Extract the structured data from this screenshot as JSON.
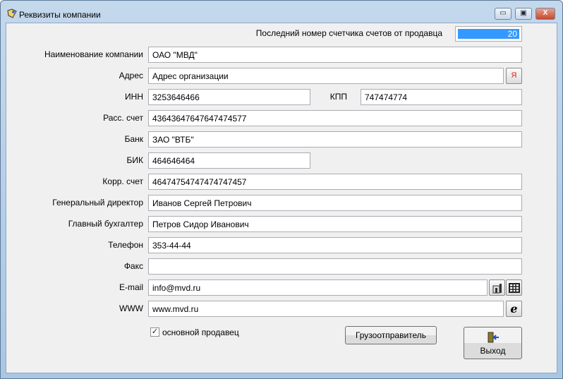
{
  "window": {
    "title": "Реквизиты компании",
    "minimize": "▭",
    "maximize": "▣",
    "close": "X"
  },
  "counter": {
    "label": "Последний номер счетчика счетов от продавца",
    "value": "20"
  },
  "fields": {
    "name": {
      "label": "Наименование компании",
      "value": "ОАО \"МВД\""
    },
    "address": {
      "label": "Адрес",
      "value": "Адрес организации",
      "button": "Я"
    },
    "inn": {
      "label": "ИНН",
      "value": "3253646466"
    },
    "kpp": {
      "label": "КПП",
      "value": "747474774"
    },
    "account": {
      "label": "Расс. счет",
      "value": "43643647647647474577"
    },
    "bank": {
      "label": "Банк",
      "value": "ЗАО \"ВТБ\""
    },
    "bik": {
      "label": "БИК",
      "value": "464646464"
    },
    "corr": {
      "label": "Корр. счет",
      "value": "46474754747474747457"
    },
    "director": {
      "label": "Генеральный директор",
      "value": "Иванов Сергей Петрович"
    },
    "accountant": {
      "label": "Главный бухгалтер",
      "value": "Петров Сидор Иванович"
    },
    "phone": {
      "label": "Телефон",
      "value": "353-44-44"
    },
    "fax": {
      "label": "Факс",
      "value": ""
    },
    "email": {
      "label": "E-mail",
      "value": "info@mvd.ru"
    },
    "www": {
      "label": "WWW",
      "value": "www.mvd.ru"
    }
  },
  "main_seller": {
    "label": "основной продавец",
    "checked": true
  },
  "buttons": {
    "shipper": "Грузоотправитель",
    "exit": "Выход"
  }
}
